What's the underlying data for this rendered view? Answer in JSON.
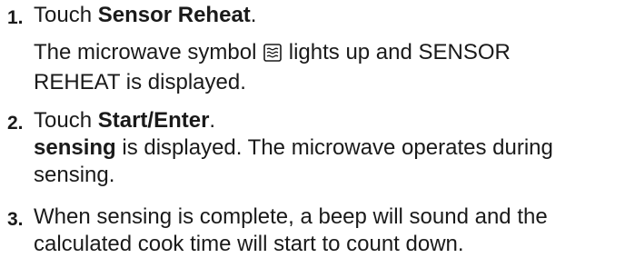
{
  "steps": [
    {
      "number": "1.",
      "instruction_prefix": "Touch ",
      "instruction_bold": "Sensor Reheat",
      "instruction_suffix": ".",
      "detail_line1_before_icon": "The microwave symbol ",
      "detail_icon": "microwave-symbol-icon",
      "detail_line1_after_icon": " lights up and SENSOR",
      "detail_line2": "REHEAT is displayed."
    },
    {
      "number": "2.",
      "instruction_prefix": "Touch ",
      "instruction_bold": "Start/Enter",
      "instruction_suffix": ".",
      "detail_bold": " sensing",
      "detail_line1_rest": " is displayed. The microwave operates during",
      "detail_line2": "sensing."
    },
    {
      "number": "3.",
      "line1": "When sensing is complete, a beep will sound and the",
      "line2": "calculated cook time will start to count down."
    }
  ]
}
